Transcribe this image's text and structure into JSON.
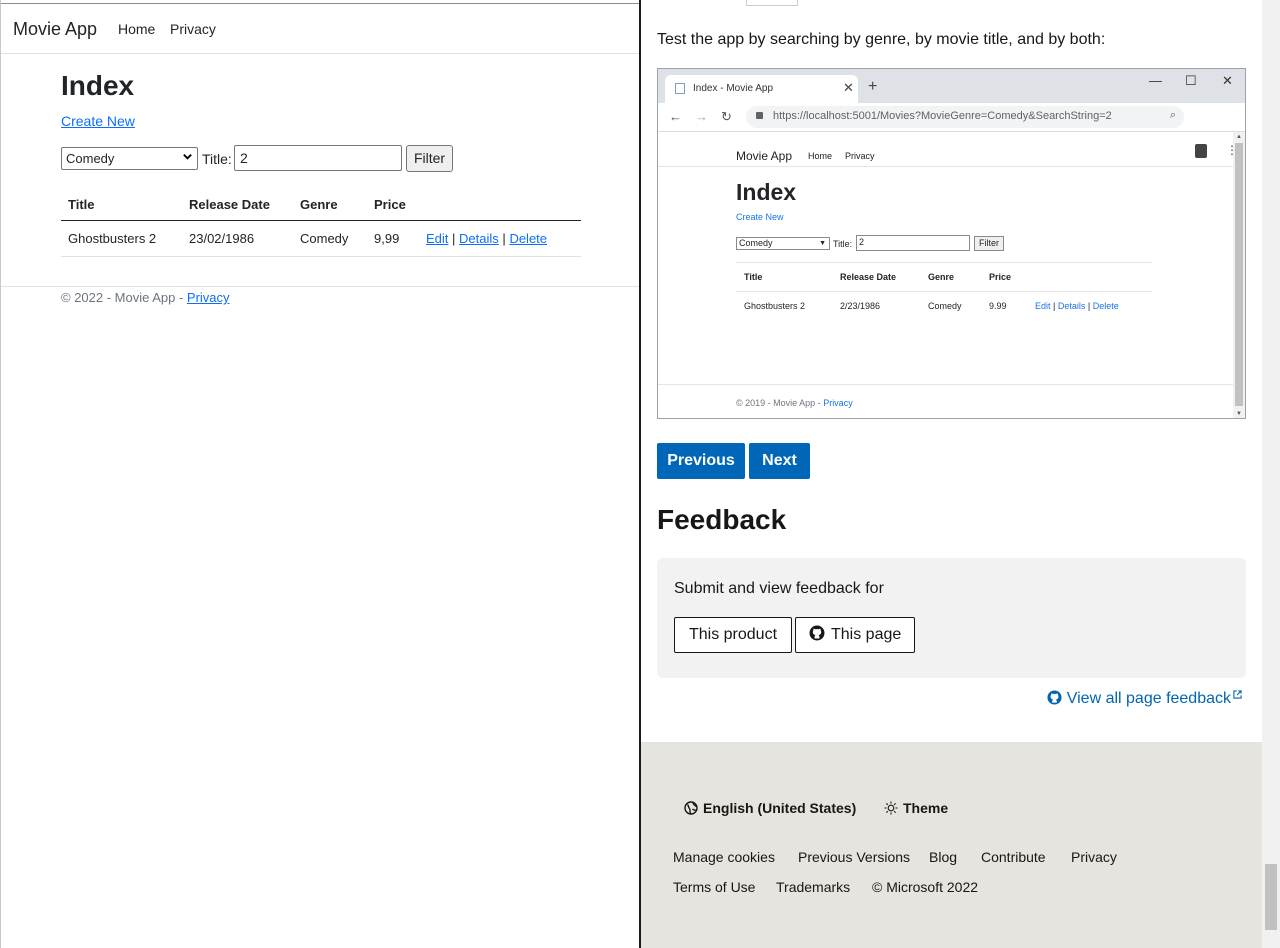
{
  "left": {
    "nav": {
      "brand": "Movie App",
      "home": "Home",
      "privacy": "Privacy"
    },
    "heading": "Index",
    "create_new": "Create New",
    "genre_select": "Comedy",
    "title_label": "Title:",
    "title_value": "2",
    "filter_label": "Filter",
    "table": {
      "headers": [
        "Title",
        "Release Date",
        "Genre",
        "Price"
      ],
      "row": {
        "title": "Ghostbusters 2",
        "date": "23/02/1986",
        "genre": "Comedy",
        "price": "9,99"
      },
      "actions": {
        "edit": "Edit",
        "details": "Details",
        "delete": "Delete",
        "sep": "|"
      }
    },
    "footer": {
      "text": "© 2022 - Movie App - ",
      "privacy": "Privacy"
    }
  },
  "right": {
    "intro": "Test the app by searching by genre, by movie title, and by both:",
    "screenshot": {
      "tab_title": "Index - Movie App",
      "url": "https://localhost:5001/Movies?MovieGenre=Comedy&SearchString=2",
      "brand": "Movie App",
      "home": "Home",
      "privacy": "Privacy",
      "heading": "Index",
      "create_new": "Create New",
      "genre_select": "Comedy",
      "title_label": "Title:",
      "title_value": "2",
      "filter_label": "Filter",
      "headers": [
        "Title",
        "Release Date",
        "Genre",
        "Price"
      ],
      "row": {
        "title": "Ghostbusters 2",
        "date": "2/23/1986",
        "genre": "Comedy",
        "price": "9.99"
      },
      "actions": {
        "edit": "Edit",
        "details": "Details",
        "delete": "Delete",
        "sep": "|"
      },
      "footer": {
        "text": "© 2019 - Movie App - ",
        "privacy": "Privacy"
      }
    },
    "buttons": {
      "previous": "Previous",
      "next": "Next"
    },
    "feedback": {
      "heading": "Feedback",
      "prompt": "Submit and view feedback for",
      "this_product": "This product",
      "this_page": "This page",
      "view_all": "View all page feedback"
    },
    "site_footer": {
      "locale": "English (United States)",
      "theme": "Theme",
      "links_row1": [
        "Manage cookies",
        "Previous Versions",
        "Blog",
        "Contribute",
        "Privacy"
      ],
      "links_row2": [
        "Terms of Use",
        "Trademarks",
        "© Microsoft 2022"
      ]
    }
  },
  "colors": {
    "link": "#0d6efd",
    "docs_primary": "#0067b8",
    "footer_bg": "#e6e4df",
    "feedback_bg": "#f2f2f2"
  },
  "icons": [
    "chevron-down-icon",
    "github-icon",
    "external-link-icon",
    "globe-icon",
    "sun-icon",
    "lock-icon",
    "search-icon",
    "back-icon",
    "forward-icon",
    "reload-icon"
  ]
}
